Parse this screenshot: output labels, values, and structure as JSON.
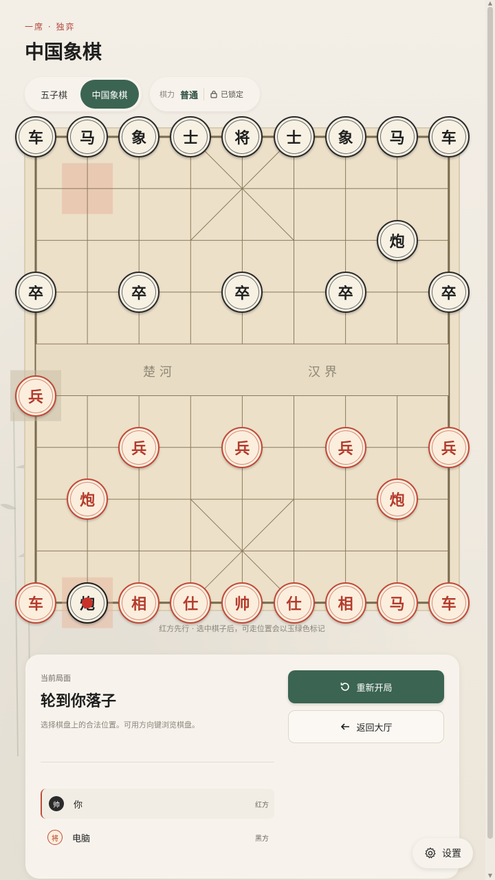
{
  "header": {
    "eyebrow": "一席 · 独弈",
    "title": "中国象棋"
  },
  "game_switch": {
    "options": [
      "五子棋",
      "中国象棋"
    ],
    "active_index": 1
  },
  "level": {
    "label": "棋力",
    "value": "普通",
    "lock_text": "已锁定"
  },
  "board": {
    "river_left": "楚河",
    "river_right": "汉界",
    "last_move_from": {
      "file": 1,
      "rank": 1
    },
    "last_move_to": {
      "file": 0,
      "rank": 5
    },
    "selected": {
      "file": 1,
      "rank": 9
    },
    "pieces": [
      {
        "side": "black",
        "char": "车",
        "file": 0,
        "rank": 0
      },
      {
        "side": "black",
        "char": "马",
        "file": 1,
        "rank": 0
      },
      {
        "side": "black",
        "char": "象",
        "file": 2,
        "rank": 0
      },
      {
        "side": "black",
        "char": "士",
        "file": 3,
        "rank": 0
      },
      {
        "side": "black",
        "char": "将",
        "file": 4,
        "rank": 0
      },
      {
        "side": "black",
        "char": "士",
        "file": 5,
        "rank": 0
      },
      {
        "side": "black",
        "char": "象",
        "file": 6,
        "rank": 0
      },
      {
        "side": "black",
        "char": "马",
        "file": 7,
        "rank": 0
      },
      {
        "side": "black",
        "char": "车",
        "file": 8,
        "rank": 0
      },
      {
        "side": "black",
        "char": "炮",
        "file": 7,
        "rank": 2
      },
      {
        "side": "black",
        "char": "卒",
        "file": 0,
        "rank": 3
      },
      {
        "side": "black",
        "char": "卒",
        "file": 2,
        "rank": 3
      },
      {
        "side": "black",
        "char": "卒",
        "file": 4,
        "rank": 3
      },
      {
        "side": "black",
        "char": "卒",
        "file": 6,
        "rank": 3
      },
      {
        "side": "black",
        "char": "卒",
        "file": 8,
        "rank": 3
      },
      {
        "side": "red",
        "char": "兵",
        "file": 0,
        "rank": 5
      },
      {
        "side": "red",
        "char": "兵",
        "file": 2,
        "rank": 6
      },
      {
        "side": "red",
        "char": "兵",
        "file": 4,
        "rank": 6
      },
      {
        "side": "red",
        "char": "兵",
        "file": 6,
        "rank": 6
      },
      {
        "side": "red",
        "char": "兵",
        "file": 8,
        "rank": 6
      },
      {
        "side": "red",
        "char": "炮",
        "file": 1,
        "rank": 7
      },
      {
        "side": "red",
        "char": "炮",
        "file": 7,
        "rank": 7
      },
      {
        "side": "red",
        "char": "车",
        "file": 0,
        "rank": 9
      },
      {
        "side": "black",
        "char": "炮",
        "file": 1,
        "rank": 9
      },
      {
        "side": "red",
        "char": "相",
        "file": 2,
        "rank": 9
      },
      {
        "side": "red",
        "char": "仕",
        "file": 3,
        "rank": 9
      },
      {
        "side": "red",
        "char": "帅",
        "file": 4,
        "rank": 9
      },
      {
        "side": "red",
        "char": "仕",
        "file": 5,
        "rank": 9
      },
      {
        "side": "red",
        "char": "相",
        "file": 6,
        "rank": 9
      },
      {
        "side": "red",
        "char": "马",
        "file": 7,
        "rank": 9
      },
      {
        "side": "red",
        "char": "车",
        "file": 8,
        "rank": 9
      }
    ],
    "hint": "红方先行 · 选中棋子后，可走位置会以玉绿色标记"
  },
  "panel": {
    "eyebrow": "当前局面",
    "title": "轮到你落子",
    "desc": "选择棋盘上的合法位置。可用方向键浏览棋盘。",
    "restart_label": "重新开局",
    "back_label": "返回大厅",
    "players": [
      {
        "badge": "帅",
        "name": "你",
        "side": "红方",
        "active": true
      },
      {
        "badge": "将",
        "name": "电脑",
        "side": "黑方",
        "active": false
      }
    ]
  },
  "settings": {
    "label": "设置"
  },
  "colors": {
    "accent_green": "#3c6452",
    "red_piece": "#b43b2c",
    "board": "#ede0c8"
  }
}
